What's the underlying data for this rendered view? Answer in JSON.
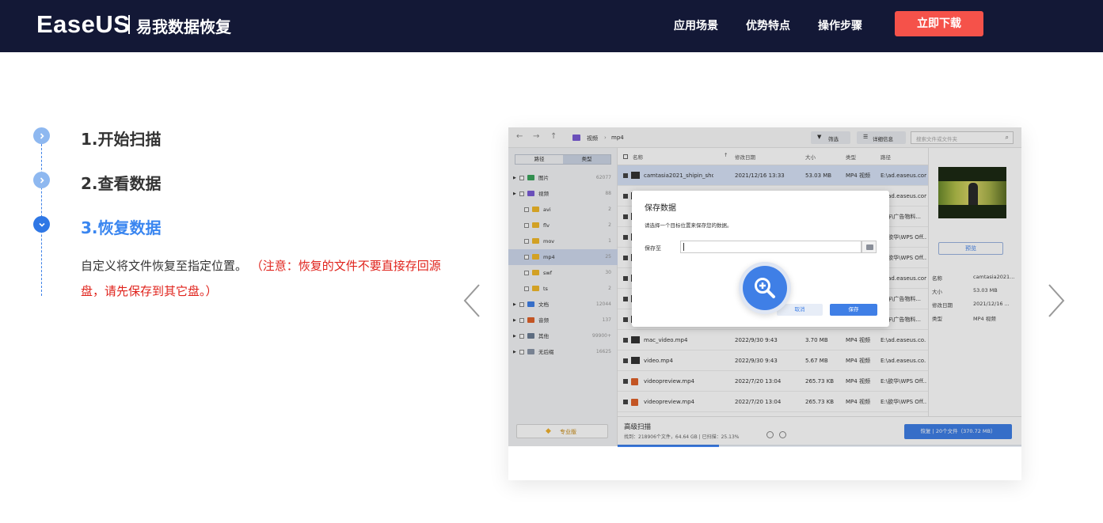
{
  "header": {
    "logo_text": "EaseUS",
    "brand_cn": "易我数据恢复",
    "nav": [
      "应用场景",
      "优势特点",
      "操作步骤"
    ],
    "download_button": "立即下载"
  },
  "steps": [
    {
      "label": "1.开始扫描",
      "active": false
    },
    {
      "label": "2.查看数据",
      "active": false
    },
    {
      "label": "3.恢复数据",
      "active": true
    }
  ],
  "description": {
    "text": "自定义将文件恢复至指定位置。",
    "note": "（注意：恢复的文件不要直接存回源盘，请先保存到其它盘。）"
  },
  "carousel": {
    "prev_icon": "chevron-left-icon",
    "next_icon": "chevron-right-icon"
  },
  "app": {
    "breadcrumb": [
      "视频",
      "mp4"
    ],
    "filter_label": "筛选",
    "detail_label": "详细信息",
    "search_placeholder": "搜索文件或文件夹",
    "side_tabs": [
      "路径",
      "类型"
    ],
    "tree": [
      {
        "label": "图片",
        "count": "62077"
      },
      {
        "label": "视频",
        "count": "88"
      },
      {
        "label": "avi",
        "count": "2"
      },
      {
        "label": "flv",
        "count": "2"
      },
      {
        "label": "mov",
        "count": "1"
      },
      {
        "label": "mp4",
        "count": "25"
      },
      {
        "label": "swf",
        "count": "30"
      },
      {
        "label": "ts",
        "count": "2"
      },
      {
        "label": "文档",
        "count": "12044"
      },
      {
        "label": "音频",
        "count": "137"
      },
      {
        "label": "其他",
        "count": "99900+"
      },
      {
        "label": "无后缀",
        "count": "16625"
      }
    ],
    "columns": [
      "名称",
      "修改日期",
      "大小",
      "类型",
      "路径"
    ],
    "rows": [
      {
        "name": "camtasia2021_shipin_shouye1...",
        "date": "2021/12/16 13:33",
        "size": "53.03 MB",
        "type": "MP4 视频",
        "path": "E:\\ad.easeus.com.c..."
      },
      {
        "name": "",
        "date": "",
        "size": "",
        "type": "",
        "path": "E:\\ad.easeus.com.c..."
      },
      {
        "name": "",
        "date": "",
        "size": "",
        "type": "",
        "path": "工作\\广告物料..."
      },
      {
        "name": "",
        "date": "",
        "size": "",
        "type": "",
        "path": "E:\\欲华\\WPS Off..."
      },
      {
        "name": "",
        "date": "",
        "size": "",
        "type": "",
        "path": "E:\\欲华\\WPS Off..."
      },
      {
        "name": "",
        "date": "",
        "size": "",
        "type": "",
        "path": "E:\\ad.easeus.com.c..."
      },
      {
        "name": "",
        "date": "",
        "size": "",
        "type": "",
        "path": "工作\\广告物料..."
      },
      {
        "name": "",
        "date": "",
        "size": "",
        "type": "",
        "path": "工作\\广告物料..."
      },
      {
        "name": "mac_video.mp4",
        "date": "2022/9/30 9:43",
        "size": "3.70 MB",
        "type": "MP4 视频",
        "path": "E:\\ad.easeus.co..."
      },
      {
        "name": "video.mp4",
        "date": "2022/9/30 9:43",
        "size": "5.67 MB",
        "type": "MP4 视频",
        "path": "E:\\ad.easeus.co..."
      },
      {
        "name": "videopreview.mp4",
        "date": "2022/7/20 13:04",
        "size": "265.73 KB",
        "type": "MP4 视频",
        "path": "E:\\欲华\\WPS Off..."
      },
      {
        "name": "videopreview.mp4",
        "date": "2022/7/20 13:04",
        "size": "265.73 KB",
        "type": "MP4 视频",
        "path": "E:\\欲华\\WPS Off..."
      }
    ],
    "preview_button": "预览",
    "details": [
      {
        "k": "名称",
        "v": "camtasia2021..."
      },
      {
        "k": "大小",
        "v": "53.03 MB"
      },
      {
        "k": "修改日期",
        "v": "2021/12/16 ..."
      },
      {
        "k": "类型",
        "v": "MP4 视频"
      }
    ],
    "pro_button": "专业版",
    "scan_title": "高级扫描",
    "scan_status": "找到：218906个文件，64.64 GB | 已扫描：25.13%",
    "scan_progress": 0.25,
    "recover_button": "恢复 | 20个文件（370.72 MB）",
    "dialog": {
      "title": "保存数据",
      "message": "请选择一个目标位置来保存您的数据。",
      "save_to_label": "保存至",
      "cancel": "取消",
      "save": "保存"
    }
  }
}
